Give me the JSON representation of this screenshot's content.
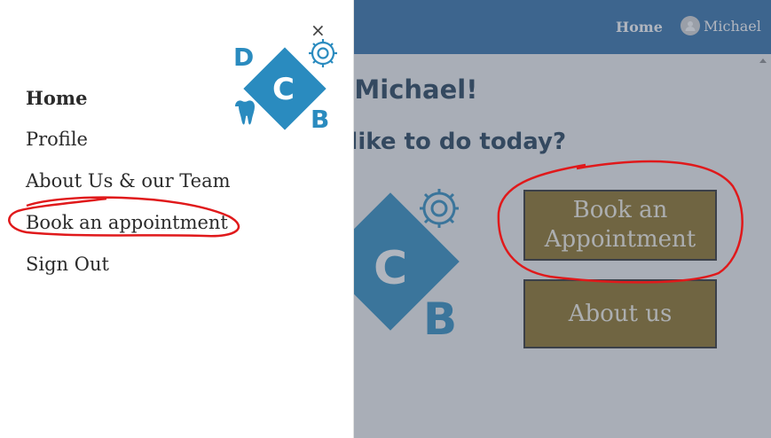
{
  "nav": {
    "home_label": "Home",
    "user_label": "Michael"
  },
  "main": {
    "welcome_text": "ne Michael!",
    "question_text": "ou like to do today?",
    "book_button_line1": "Book an",
    "book_button_line2": "Appointment",
    "about_button": "About us"
  },
  "drawer": {
    "close_symbol": "×",
    "items": [
      {
        "label": "Home"
      },
      {
        "label": "Profile"
      },
      {
        "label": "About Us & our Team"
      },
      {
        "label": "Book an appointment"
      },
      {
        "label": "Sign Out"
      }
    ]
  },
  "logo": {
    "letter_top": "D",
    "letter_center": "C",
    "letter_bottom": "B"
  },
  "colors": {
    "nav_bg": "#2f6ea8",
    "button_bg": "#8a6e1e",
    "logo_blue": "#2a8bbf",
    "annotation_red": "#e0191b"
  },
  "icons": [
    "close-icon",
    "user-avatar-icon",
    "gear-icon",
    "tooth-icon"
  ]
}
